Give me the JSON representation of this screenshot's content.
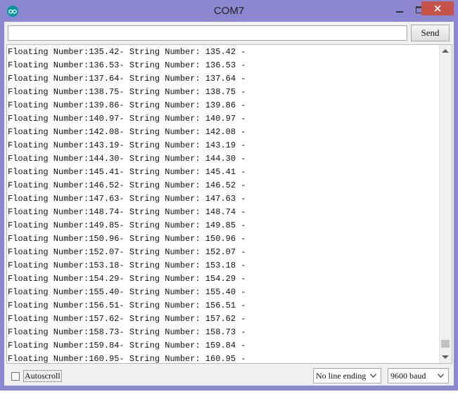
{
  "window": {
    "title": "COM7"
  },
  "toolbar": {
    "send_label": "Send",
    "input_value": ""
  },
  "output": {
    "lines": [
      "Floating Number:135.42- String Number: 135.42 -",
      "Floating Number:136.53- String Number: 136.53 -",
      "Floating Number:137.64- String Number: 137.64 -",
      "Floating Number:138.75- String Number: 138.75 -",
      "Floating Number:139.86- String Number: 139.86 -",
      "Floating Number:140.97- String Number: 140.97 -",
      "Floating Number:142.08- String Number: 142.08 -",
      "Floating Number:143.19- String Number: 143.19 -",
      "Floating Number:144.30- String Number: 144.30 -",
      "Floating Number:145.41- String Number: 145.41 -",
      "Floating Number:146.52- String Number: 146.52 -",
      "Floating Number:147.63- String Number: 147.63 -",
      "Floating Number:148.74- String Number: 148.74 -",
      "Floating Number:149.85- String Number: 149.85 -",
      "Floating Number:150.96- String Number: 150.96 -",
      "Floating Number:152.07- String Number: 152.07 -",
      "Floating Number:153.18- String Number: 153.18 -",
      "Floating Number:154.29- String Number: 154.29 -",
      "Floating Number:155.40- String Number: 155.40 -",
      "Floating Number:156.51- String Number: 156.51 -",
      "Floating Number:157.62- String Number: 157.62 -",
      "Floating Number:158.73- String Number: 158.73 -",
      "Floating Number:159.84- String Number: 159.84 -",
      "Floating Number:160.95- String Number: 160.95 -"
    ]
  },
  "footer": {
    "autoscroll_label": "Autoscroll",
    "autoscroll_checked": false,
    "line_ending": "No line ending",
    "baud_rate": "9600 baud"
  },
  "icons": {
    "app": "arduino-icon",
    "minimize": "minimize-icon",
    "maximize": "maximize-icon",
    "close": "close-icon",
    "dropdown": "chevron-down-icon"
  },
  "colors": {
    "window_frame": "#8b87d1",
    "close_button": "#c7514b",
    "app_icon": "#00979c"
  }
}
